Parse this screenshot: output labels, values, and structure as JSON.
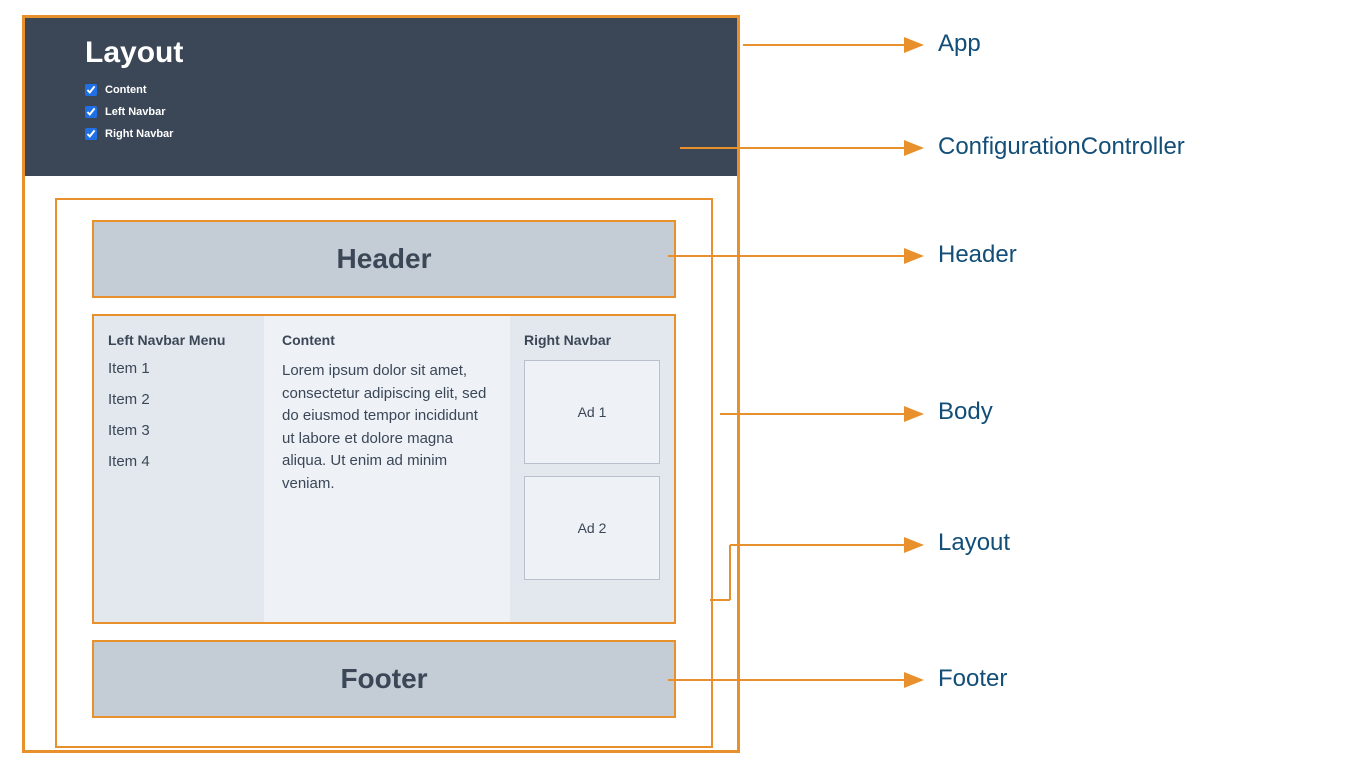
{
  "config": {
    "title": "Layout",
    "checks": [
      {
        "label": "Content",
        "checked": true
      },
      {
        "label": "Left Navbar",
        "checked": true
      },
      {
        "label": "Right Navbar",
        "checked": true
      }
    ]
  },
  "header": {
    "title": "Header"
  },
  "body": {
    "leftNav": {
      "title": "Left Navbar Menu",
      "items": [
        "Item 1",
        "Item 2",
        "Item 3",
        "Item 4"
      ]
    },
    "content": {
      "title": "Content",
      "text": "Lorem ipsum dolor sit amet, consectetur adipiscing elit, sed do eiusmod tempor incididunt ut labore et dolore magna aliqua. Ut enim ad minim veniam."
    },
    "rightNav": {
      "title": "Right Navbar",
      "ads": [
        "Ad 1",
        "Ad 2"
      ]
    }
  },
  "footer": {
    "title": "Footer"
  },
  "labels": {
    "app": "App",
    "config": "ConfigurationController",
    "header": "Header",
    "body": "Body",
    "layout": "Layout",
    "footer": "Footer"
  }
}
